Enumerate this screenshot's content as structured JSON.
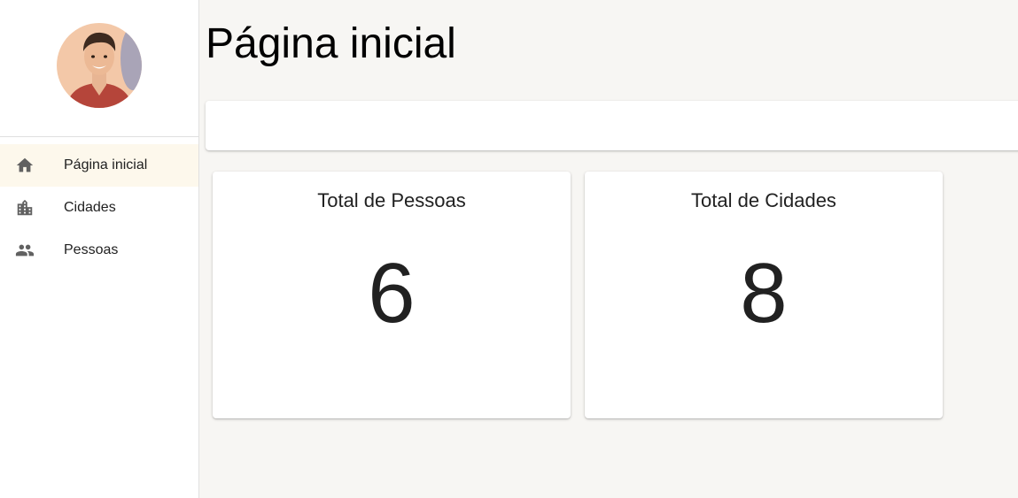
{
  "sidebar": {
    "items": [
      {
        "label": "Página inicial",
        "icon": "home-icon",
        "active": true
      },
      {
        "label": "Cidades",
        "icon": "city-icon",
        "active": false
      },
      {
        "label": "Pessoas",
        "icon": "people-icon",
        "active": false
      }
    ]
  },
  "main": {
    "title": "Página inicial",
    "cards": [
      {
        "title": "Total de Pessoas",
        "value": "6"
      },
      {
        "title": "Total de Cidades",
        "value": "8"
      }
    ]
  },
  "colors": {
    "background": "#f7f6f3",
    "active_item": "#fdf8ec",
    "icon": "#616161",
    "text": "#212121"
  }
}
